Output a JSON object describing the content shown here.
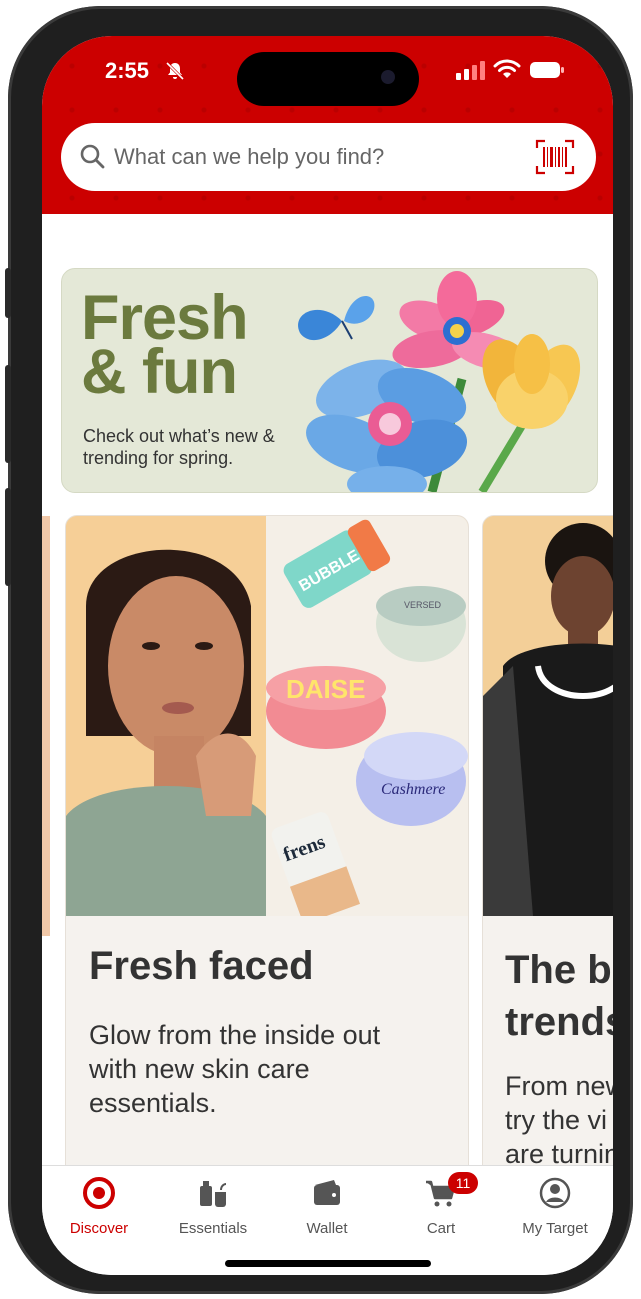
{
  "status_bar": {
    "time": "2:55"
  },
  "search": {
    "placeholder": "What can we help you find?"
  },
  "banner": {
    "title_line1": "Fresh",
    "title_line2": "& fun",
    "subtitle": "Check out what’s new & trending for spring."
  },
  "cards": [
    {
      "title": "Fresh faced",
      "body": "Glow from the inside out with new skin care essentials."
    },
    {
      "title_line1": "The b",
      "title_line2": "trends",
      "body_line1": "From new",
      "body_line2": "try the vi",
      "body_line3": "are turnin"
    }
  ],
  "product_labels": {
    "bubble": "BUBBLE",
    "versed": "VERSED",
    "daise": "DAISE",
    "cashmere": "Cashmere",
    "frens": "frens"
  },
  "tabbar": {
    "items": [
      {
        "label": "Discover",
        "icon": "target-logo-icon",
        "active": true
      },
      {
        "label": "Essentials",
        "icon": "essentials-icon"
      },
      {
        "label": "Wallet",
        "icon": "wallet-icon"
      },
      {
        "label": "Cart",
        "icon": "cart-icon",
        "badge": "11"
      },
      {
        "label": "My Target",
        "icon": "profile-icon"
      }
    ]
  },
  "colors": {
    "brand_red": "#cc0000",
    "banner_bg": "#e4e8d7",
    "banner_title": "#6b7a3e",
    "card_bg": "#f5f2ee"
  }
}
